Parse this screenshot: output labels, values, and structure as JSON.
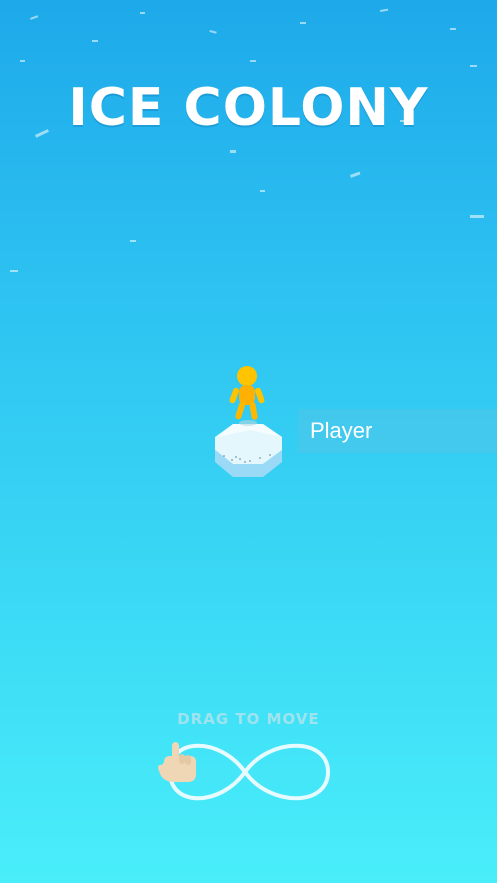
{
  "game": {
    "title": "ICE COLONY",
    "player_label": "Player",
    "hint": "DRAG TO MOVE"
  },
  "colors": {
    "sky_top": "#1ea9ea",
    "sea_bottom": "#49eefa",
    "player": "#ffc400",
    "ice_top": "#dff5fb",
    "ice_side": "#8ad6f5"
  },
  "icons": [
    "hand-pointer-icon",
    "infinity-path-icon"
  ]
}
